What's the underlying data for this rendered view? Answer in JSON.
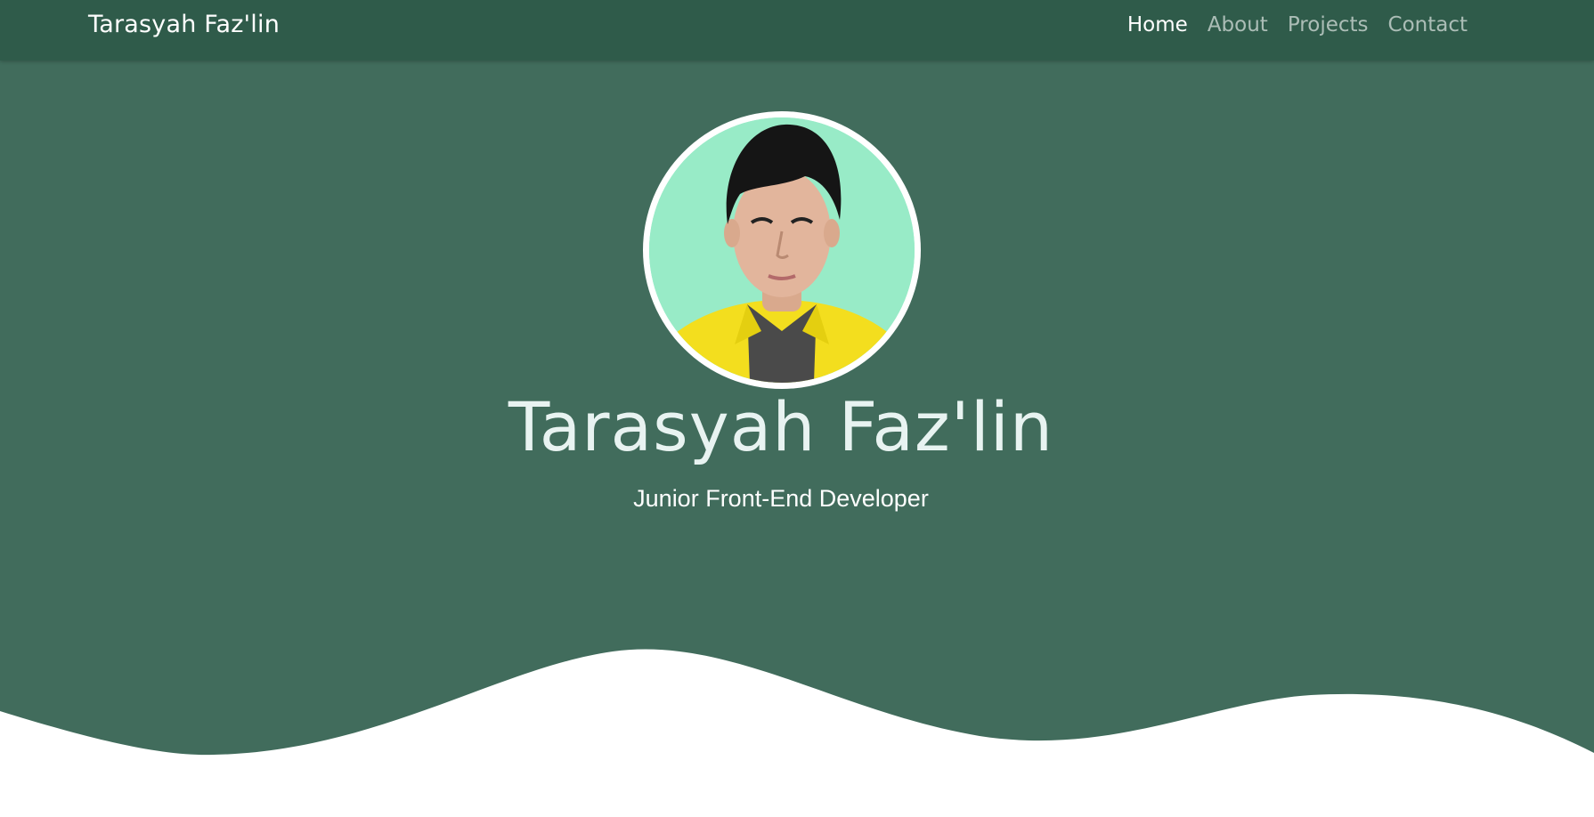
{
  "navbar": {
    "brand": "Tarasyah Faz'lin",
    "links": [
      {
        "label": "Home",
        "active": true
      },
      {
        "label": "About",
        "active": false
      },
      {
        "label": "Projects",
        "active": false
      },
      {
        "label": "Contact",
        "active": false
      }
    ]
  },
  "hero": {
    "title": "Tarasyah Faz'lin",
    "subtitle": "Junior Front-End Developer",
    "avatar_icon": "profile-photo"
  },
  "colors": {
    "navbar_bg": "#2f5b4a",
    "hero_bg": "#416c5c",
    "avatar_bg": "#98ebc7",
    "jacket": "#f3de1e",
    "wave": "#ffffff"
  }
}
